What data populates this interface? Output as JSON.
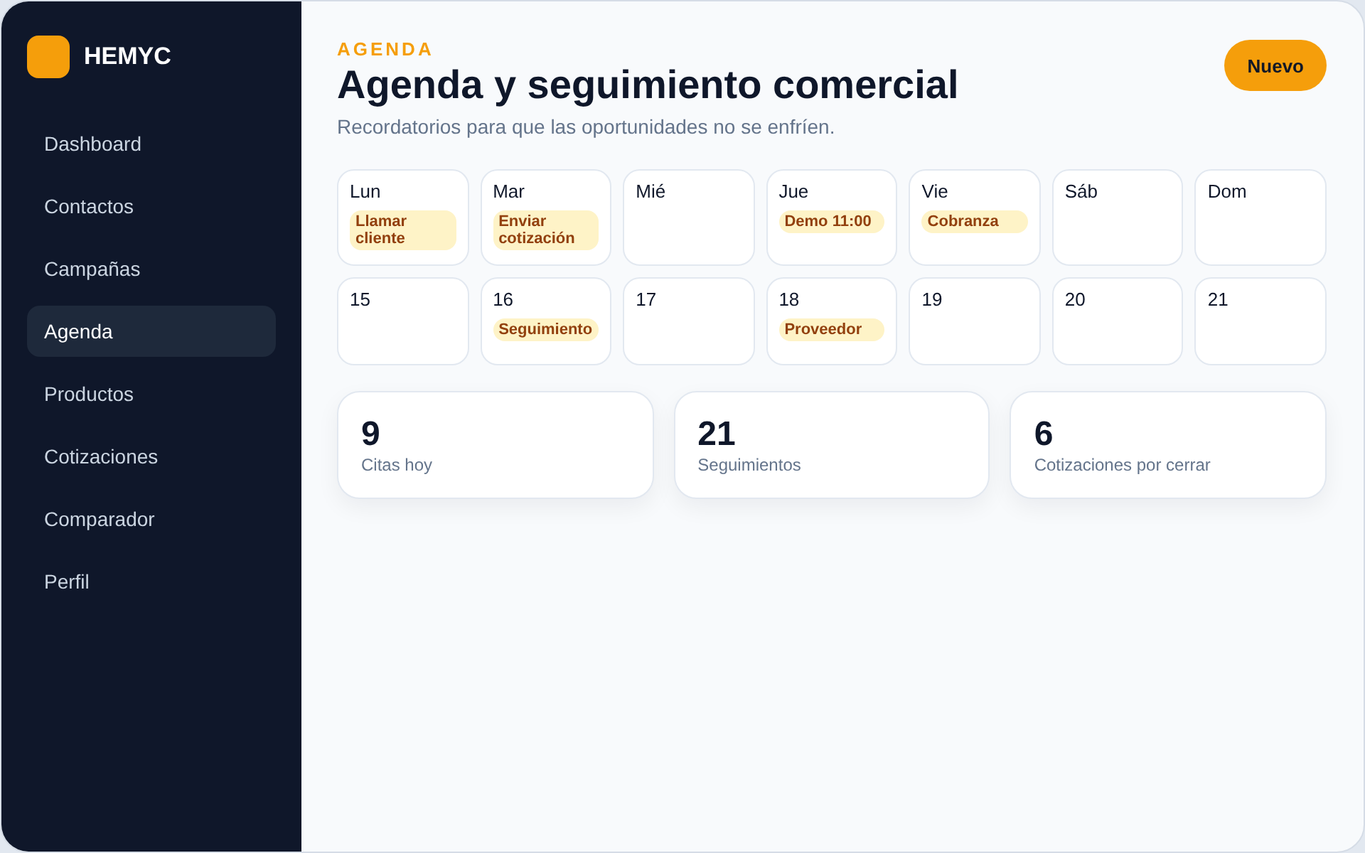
{
  "brand": {
    "name": "HEMYC"
  },
  "sidebar": {
    "items": [
      {
        "label": "Dashboard",
        "selected": false
      },
      {
        "label": "Contactos",
        "selected": false
      },
      {
        "label": "Campañas",
        "selected": false
      },
      {
        "label": "Agenda",
        "selected": true
      },
      {
        "label": "Productos",
        "selected": false
      },
      {
        "label": "Cotizaciones",
        "selected": false
      },
      {
        "label": "Comparador",
        "selected": false
      },
      {
        "label": "Perfil",
        "selected": false
      }
    ]
  },
  "header": {
    "eyebrow": "AGENDA",
    "title": "Agenda y seguimiento comercial",
    "subtitle": "Recordatorios para que las oportunidades no se enfríen.",
    "button": "Nuevo"
  },
  "calendar": {
    "rows": [
      [
        {
          "label": "Lun",
          "events": [
            "Llamar cliente"
          ]
        },
        {
          "label": "Mar",
          "events": [
            "Enviar cotización"
          ]
        },
        {
          "label": "Mié"
        },
        {
          "label": "Jue",
          "events": [
            "Demo 11:00"
          ]
        },
        {
          "label": "Vie",
          "events": [
            "Cobranza"
          ]
        },
        {
          "label": "Sáb"
        },
        {
          "label": "Dom"
        }
      ],
      [
        {
          "label": "15"
        },
        {
          "label": "16",
          "events": [
            "Seguimiento"
          ]
        },
        {
          "label": "17"
        },
        {
          "label": "18",
          "events": [
            "Proveedor"
          ]
        },
        {
          "label": "19"
        },
        {
          "label": "20"
        },
        {
          "label": "21"
        }
      ]
    ]
  },
  "stats": [
    {
      "value": "9",
      "label": "Citas hoy"
    },
    {
      "value": "21",
      "label": "Seguimientos"
    },
    {
      "value": "6",
      "label": "Cotizaciones por cerrar"
    }
  ]
}
